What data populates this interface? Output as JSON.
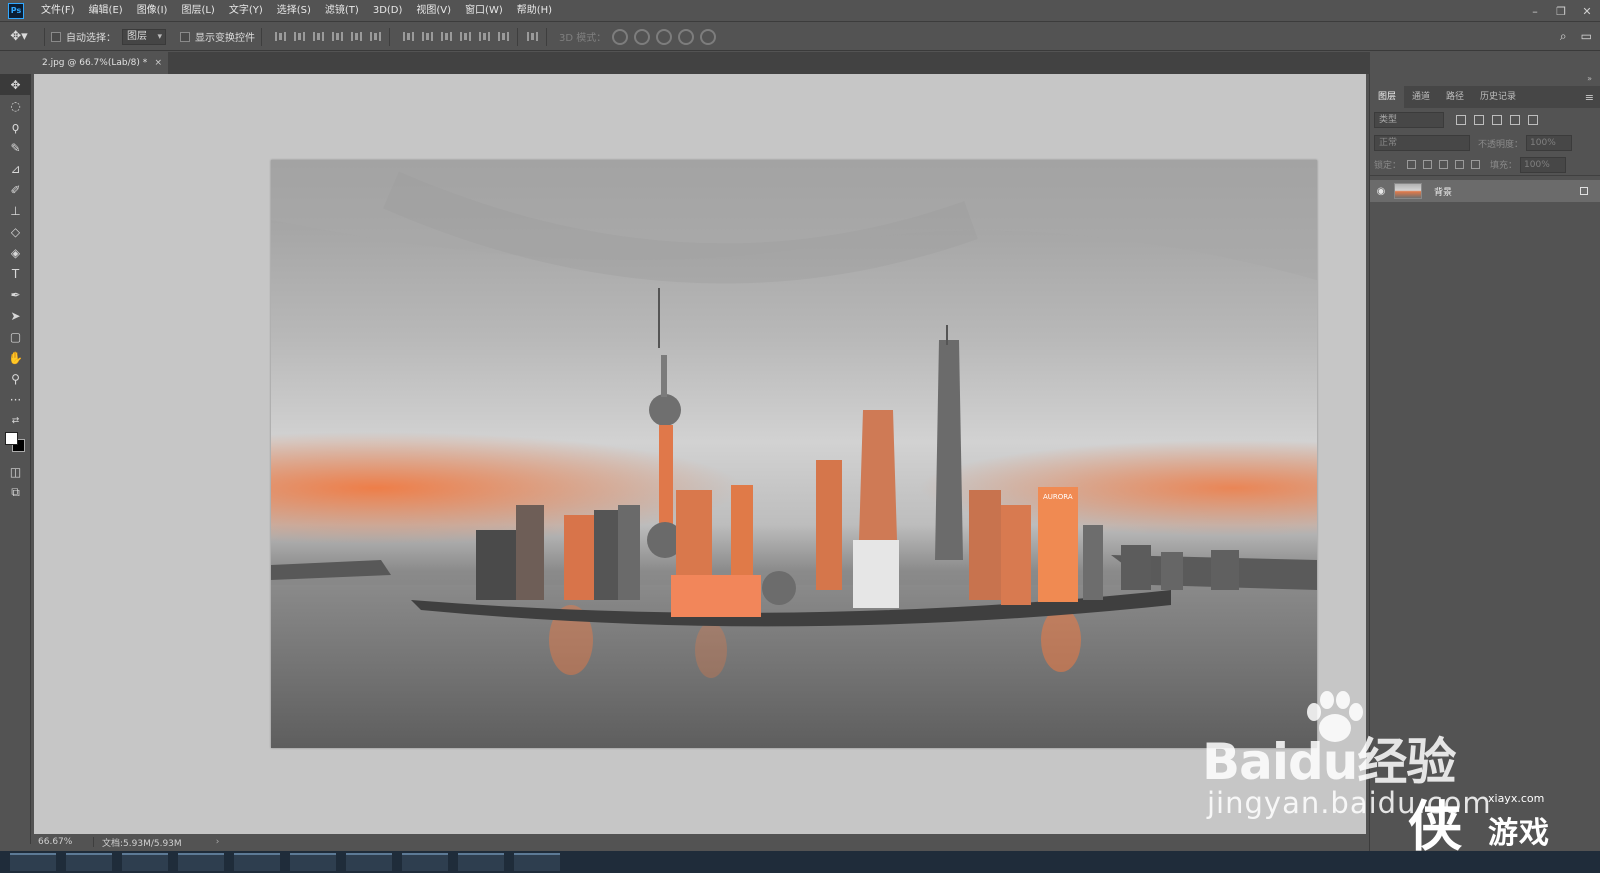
{
  "app": {
    "logo": "Ps"
  },
  "menu": [
    "文件(F)",
    "编辑(E)",
    "图像(I)",
    "图层(L)",
    "文字(Y)",
    "选择(S)",
    "滤镜(T)",
    "3D(D)",
    "视图(V)",
    "窗口(W)",
    "帮助(H)"
  ],
  "options": {
    "auto_select_label": "自动选择：",
    "auto_select_value": "图层",
    "show_transform_label": "显示变换控件",
    "mode_3d_label": "3D 模式："
  },
  "document": {
    "tab_title": "2.jpg @ 66.7%(Lab/8) *",
    "close_glyph": "×"
  },
  "status": {
    "zoom": "66.67%",
    "doc_size": "文档:5.93M/5.93M",
    "arrow": "›"
  },
  "layers_panel": {
    "tabs": [
      "图层",
      "通道",
      "路径",
      "历史记录"
    ],
    "filter_placeholder": "类型",
    "blend_mode": "正常",
    "opacity_label": "不透明度：",
    "opacity_value": "100%",
    "lock_label": "锁定：",
    "fill_label": "填充：",
    "fill_value": "100%",
    "layers": [
      {
        "name": "背景",
        "visible": true,
        "locked": true
      }
    ]
  },
  "photo": {
    "billboard_text": "AURORA",
    "tint_color": "#f07a42",
    "sky_color": "#c8c8c8",
    "water_color": "#6a6a6a"
  },
  "watermarks": {
    "baidu": "Baidu经验",
    "jingyan": "jingyan.baidu.com",
    "xiayx": "xiayx.com",
    "game": "游戏",
    "xia": "侠"
  }
}
